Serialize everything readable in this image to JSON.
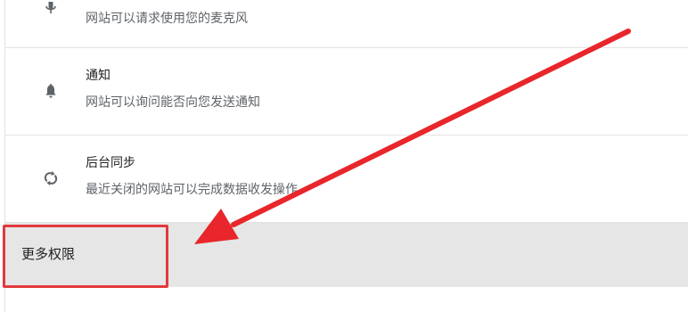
{
  "permissions": {
    "microphone": {
      "icon": "microphone-icon",
      "description": "网站可以请求使用您的麦克风"
    },
    "notifications": {
      "icon": "bell-icon",
      "title": "通知",
      "description": "网站可以询问能否向您发送通知"
    },
    "background_sync": {
      "icon": "sync-icon",
      "title": "后台同步",
      "description": "最近关闭的网站可以完成数据收发操作"
    },
    "more": {
      "label": "更多权限"
    }
  },
  "annotation": {
    "highlight_color": "#e2393d",
    "arrow_color": "#e8262b"
  }
}
